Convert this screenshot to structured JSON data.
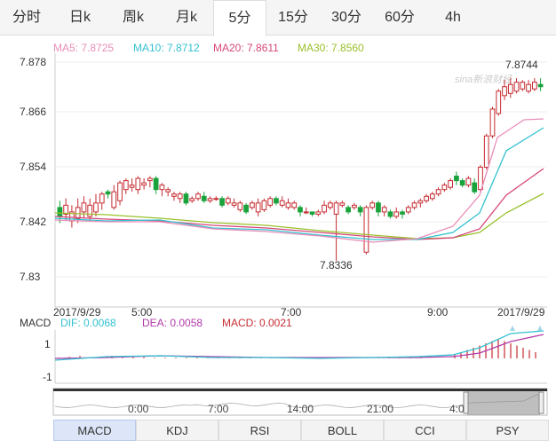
{
  "tabs": [
    "分时",
    "日k",
    "周k",
    "月k",
    "5分",
    "15分",
    "30分",
    "60分",
    "4h"
  ],
  "active_tab_index": 4,
  "ma_legend": [
    {
      "label": "MA5: 7.8725",
      "color": "#e98db8"
    },
    {
      "label": "MA10: 7.8712",
      "color": "#32c2d0"
    },
    {
      "label": "MA20: 7.8611",
      "color": "#d6477a"
    },
    {
      "label": "MA30: 7.8560",
      "color": "#99c12a"
    }
  ],
  "watermark": "sina新浪财经",
  "price_axis": [
    "7.878",
    "7.866",
    "7.854",
    "7.842",
    "7.83"
  ],
  "annotations": {
    "high": "7.8744",
    "low": "7.8336"
  },
  "time_labels": [
    "2017/9/29",
    "5:00",
    "7:00",
    "9:00",
    "2017/9/29"
  ],
  "macd": {
    "title": "MACD",
    "dif": "DIF: 0.0068",
    "dea": "DEA: 0.0058",
    "macd": "MACD: 0.0021",
    "colors": {
      "dif": "#32c2d0",
      "dea": "#b13aa9",
      "macd": "#c62c32"
    },
    "axis": [
      "1",
      "-1"
    ]
  },
  "navigator_labels": [
    "0:00",
    "7:00",
    "14:00",
    "21:00",
    "4:0"
  ],
  "bottom_tabs": [
    "MACD",
    "KDJ",
    "RSI",
    "BOLL",
    "CCI",
    "PSY"
  ],
  "active_bottom_tab_index": 0,
  "colors": {
    "up": "#c62c32",
    "down": "#1aa33c"
  }
}
